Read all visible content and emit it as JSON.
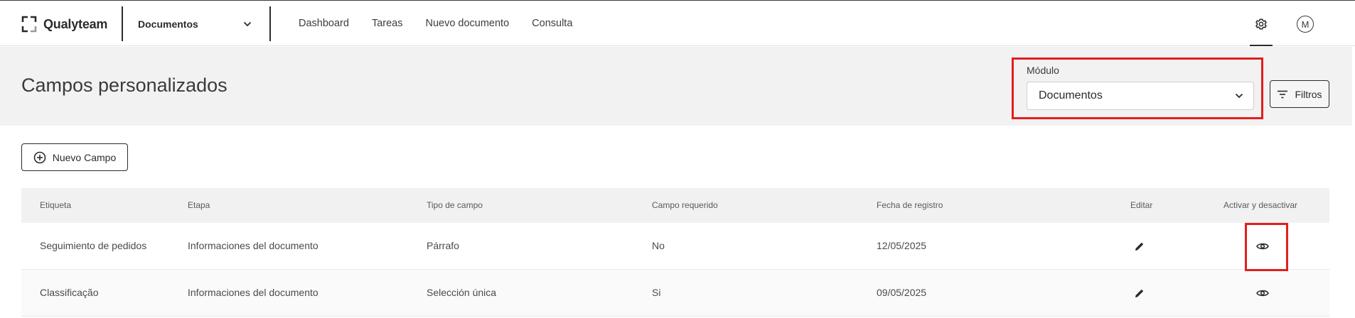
{
  "app": {
    "brand": "Qualyteam"
  },
  "topbar": {
    "module_selector": "Documentos",
    "nav": [
      "Dashboard",
      "Tareas",
      "Nuevo documento",
      "Consulta"
    ],
    "avatar_initial": "M"
  },
  "header": {
    "title": "Campos personalizados",
    "module_label": "Módulo",
    "module_value": "Documentos",
    "filters_label": "Filtros"
  },
  "actions": {
    "new_field_label": "Nuevo Campo"
  },
  "table": {
    "columns": [
      "Etiqueta",
      "Etapa",
      "Tipo de campo",
      "Campo requerido",
      "Fecha de registro",
      "Editar",
      "Activar y desactivar"
    ],
    "rows": [
      [
        "Seguimiento de pedidos",
        "Informaciones del documento",
        "Párrafo",
        "No",
        "12/05/2025"
      ],
      [
        "Classificação",
        "Informaciones del documento",
        "Selección única",
        "Si",
        "09/05/2025"
      ]
    ]
  },
  "colors": {
    "highlight": "#e21e1e",
    "header_bg": "#f2f2f2",
    "text": "#2b2b2b"
  },
  "icons": {
    "edit": "pencil-icon",
    "toggle": "eye-icon",
    "settings": "gear-icon",
    "filters": "filter-lines-icon",
    "add": "plus-circle-icon",
    "dropdown": "chevron-down-icon"
  }
}
